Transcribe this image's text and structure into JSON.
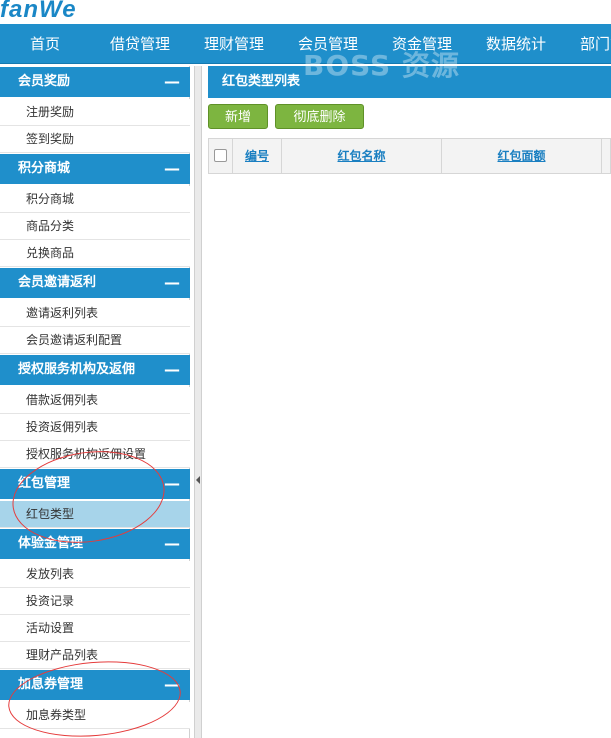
{
  "brand": {
    "logo_text": "fanWe"
  },
  "nav": {
    "items": [
      "首页",
      "借贷管理",
      "理财管理",
      "会员管理",
      "资金管理",
      "数据统计",
      "部门管"
    ]
  },
  "sidebar": {
    "sections": [
      {
        "title": "会员奖励",
        "items": [
          "注册奖励",
          "签到奖励"
        ]
      },
      {
        "title": "积分商城",
        "items": [
          "积分商城",
          "商品分类",
          "兑换商品"
        ]
      },
      {
        "title": "会员邀请返利",
        "items": [
          "邀请返利列表",
          "会员邀请返利配置"
        ]
      },
      {
        "title": "授权服务机构及返佣",
        "items": [
          "借款返佣列表",
          "投资返佣列表",
          "授权服务机构返佣设置"
        ]
      },
      {
        "title": "红包管理",
        "items": [
          "红包类型"
        ]
      },
      {
        "title": "体验金管理",
        "items": [
          "发放列表",
          "投资记录",
          "活动设置",
          "理财产品列表"
        ]
      },
      {
        "title": "加息券管理",
        "items": [
          "加息券类型"
        ]
      }
    ],
    "collapse_symbol": "—",
    "active_item": "红包类型"
  },
  "main": {
    "panel_title": "红包类型列表",
    "watermark": "BOSS 资源",
    "buttons": {
      "add": "新增",
      "delete": "彻底删除"
    },
    "table": {
      "columns": [
        "编号",
        "红包名称",
        "红包面额"
      ]
    }
  },
  "colors": {
    "primary": "#1f8fcb",
    "active_item": "#a7d4ea",
    "button": "#7db540",
    "annotation": "#e53c3c"
  }
}
